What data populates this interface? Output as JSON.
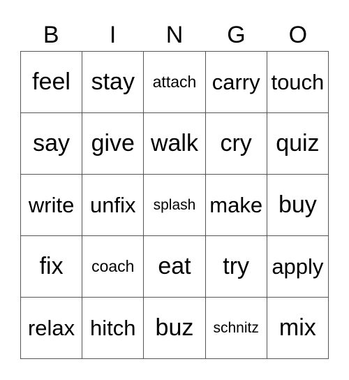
{
  "header": [
    "B",
    "I",
    "N",
    "G",
    "O"
  ],
  "rows": [
    [
      {
        "text": "feel",
        "size": "lg"
      },
      {
        "text": "stay",
        "size": "lg"
      },
      {
        "text": "attach",
        "size": "sm"
      },
      {
        "text": "carry",
        "size": "md"
      },
      {
        "text": "touch",
        "size": "md"
      }
    ],
    [
      {
        "text": "say",
        "size": "lg"
      },
      {
        "text": "give",
        "size": "lg"
      },
      {
        "text": "walk",
        "size": "lg"
      },
      {
        "text": "cry",
        "size": "lg"
      },
      {
        "text": "quiz",
        "size": "lg"
      }
    ],
    [
      {
        "text": "write",
        "size": "md"
      },
      {
        "text": "unfix",
        "size": "md"
      },
      {
        "text": "splash",
        "size": "xs"
      },
      {
        "text": "make",
        "size": "md"
      },
      {
        "text": "buy",
        "size": "lg"
      }
    ],
    [
      {
        "text": "fix",
        "size": "lg"
      },
      {
        "text": "coach",
        "size": "sm"
      },
      {
        "text": "eat",
        "size": "lg"
      },
      {
        "text": "try",
        "size": "lg"
      },
      {
        "text": "apply",
        "size": "md"
      }
    ],
    [
      {
        "text": "relax",
        "size": "md"
      },
      {
        "text": "hitch",
        "size": "md"
      },
      {
        "text": "buz",
        "size": "lg"
      },
      {
        "text": "schnitz",
        "size": "xs"
      },
      {
        "text": "mix",
        "size": "lg"
      }
    ]
  ]
}
